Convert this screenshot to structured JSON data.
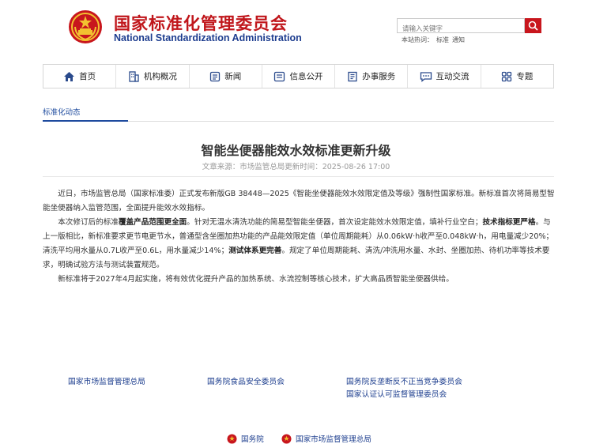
{
  "header": {
    "title_cn": "国家标准化管理委员会",
    "title_en": "National Standardization Administration"
  },
  "search": {
    "placeholder": "请输入关键字",
    "hint_label": "本站热词：",
    "hint_terms": [
      "标准",
      "通知"
    ]
  },
  "nav": {
    "items": [
      {
        "label": "首页",
        "icon": "home-icon"
      },
      {
        "label": "机构概况",
        "icon": "building-icon"
      },
      {
        "label": "新闻",
        "icon": "news-icon"
      },
      {
        "label": "信息公开",
        "icon": "info-icon"
      },
      {
        "label": "办事服务",
        "icon": "service-icon"
      },
      {
        "label": "互动交流",
        "icon": "chat-icon"
      },
      {
        "label": "专题",
        "icon": "grid-icon"
      }
    ]
  },
  "breadcrumb": "标准化动态",
  "article": {
    "title": "智能坐便器能效水效标准更新升级",
    "meta": "文章来源：市场监管总局更新时间：2025-08-26 17:00",
    "paragraphs": [
      [
        {
          "text": "近日，市场监管总局（国家标准委）正式发布新版GB 38448—2025《智能坐便器能效水效限定值及等级》强制性国家标准。新标准首次将简易型智能坐便器纳入监管范围，全面提升能效水效指标。",
          "bold": false
        }
      ],
      [
        {
          "text": "本次修订后的标准",
          "bold": false
        },
        {
          "text": "覆盖产品范围更全面",
          "bold": true
        },
        {
          "text": "。针对无温水清洗功能的简易型智能坐便器，首次设定能效水效限定值，填补行业空白；",
          "bold": false
        },
        {
          "text": "技术指标更严格",
          "bold": true
        },
        {
          "text": "。与上一版相比，新标准要求更节电更节水，普通型含坐圈加热功能的产品能效限定值（单位周期能耗）从0.06kW·h收严至0.048kW·h，用电量减少20%；清洗平均用水量从0.7L收严至0.6L，用水量减少14%；",
          "bold": false
        },
        {
          "text": "测试体系更完善",
          "bold": true
        },
        {
          "text": "。规定了单位周期能耗、清洗/冲洗用水量、水封、坐圈加热、待机功率等技术要求，明确试验方法与测试装置规范。",
          "bold": false
        }
      ],
      [
        {
          "text": "新标准将于2027年4月起实施，将有效优化提升产品的加热系统、水流控制等核心技术，扩大高品质智能坐便器供给。",
          "bold": false
        }
      ]
    ]
  },
  "footer": {
    "links": [
      "国家市场监督管理总局",
      "国务院食品安全委员会",
      "国务院反垄断反不正当竞争委员会",
      "国家认证认可监督管理委员会"
    ],
    "bottom": [
      "国务院",
      "国家市场监督管理总局"
    ]
  },
  "colors": {
    "brand_red": "#c0161b",
    "brand_blue": "#1d3d8f",
    "link_blue": "#1e4b9e",
    "search_button": "#c8161d"
  }
}
